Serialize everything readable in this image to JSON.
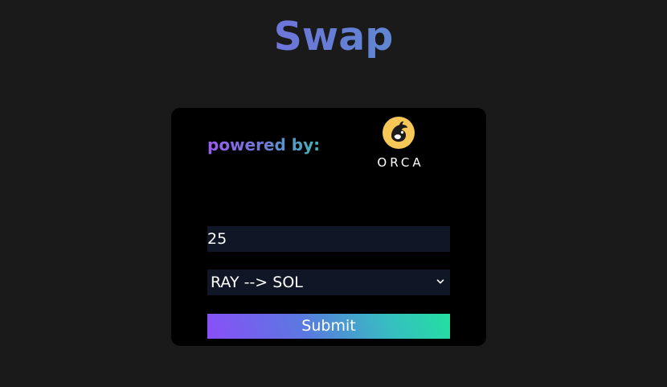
{
  "header": {
    "title": "Swap"
  },
  "card": {
    "powered_by_label": "powered by:",
    "logo": {
      "icon": "orca-whale-icon",
      "wordmark": "ORCA",
      "mark_color": "#f7c857"
    },
    "amount_input": {
      "value": "25",
      "placeholder": ""
    },
    "pair_select": {
      "selected": "RAY --> SOL",
      "icon": "chevron-down-icon"
    },
    "submit_label": "Submit"
  },
  "colors": {
    "page_background": "#1a1a1a",
    "card_background": "#000000",
    "field_background": "#101626",
    "gradient_start": "#8a4ef8",
    "gradient_end": "#23e0a0"
  }
}
